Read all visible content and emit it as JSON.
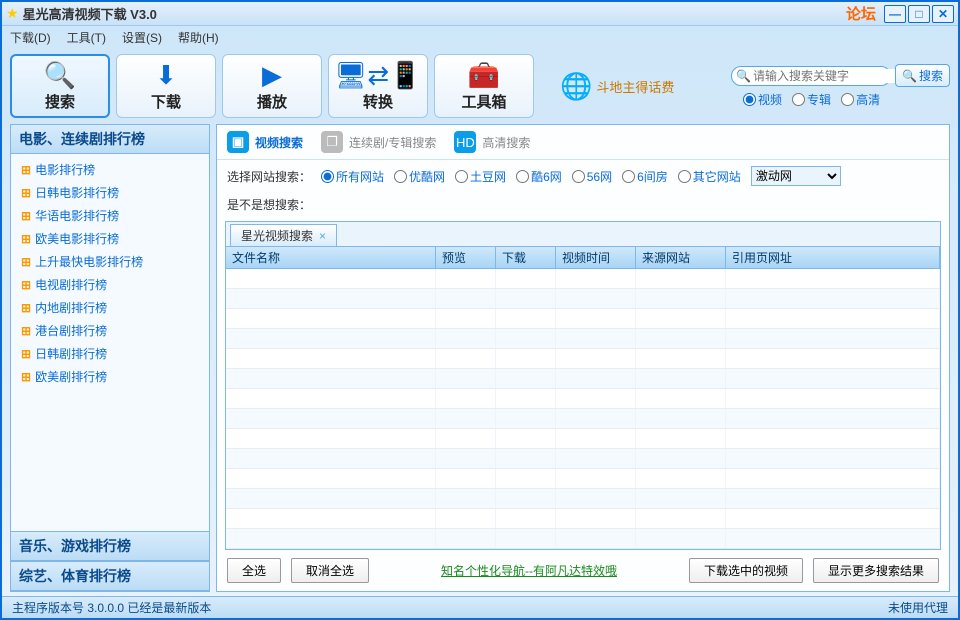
{
  "title": "星光高清视频下载  V3.0",
  "forum_link": "论坛",
  "menu": {
    "download": "下载(D)",
    "tools": "工具(T)",
    "settings": "设置(S)",
    "help": "帮助(H)"
  },
  "bigbuttons": {
    "search": "搜索",
    "download": "下载",
    "play": "播放",
    "convert": "转换",
    "toolbox": "工具箱"
  },
  "promo": "斗地主得话费",
  "search": {
    "placeholder": "请输入搜索关键字",
    "button": "搜索",
    "radios": {
      "video": "视频",
      "album": "专辑",
      "hd": "高清"
    }
  },
  "sidebar": {
    "headers": {
      "movies": "电影、连续剧排行榜",
      "music": "音乐、游戏排行榜",
      "variety": "综艺、体育排行榜"
    },
    "items": [
      "电影排行榜",
      "日韩电影排行榜",
      "华语电影排行榜",
      "欧美电影排行榜",
      "上升最快电影排行榜",
      "电视剧排行榜",
      "内地剧排行榜",
      "港台剧排行榜",
      "日韩剧排行榜",
      "欧美剧排行榜"
    ]
  },
  "main_tabs": {
    "video": "视频搜索",
    "series": "连续剧/专辑搜索",
    "hd": "高清搜索"
  },
  "filter": {
    "label": "选择网站搜索：",
    "sites": {
      "all": "所有网站",
      "youku": "优酷网",
      "tudou": "土豆网",
      "ku6": "酷6网",
      "w56": "56网",
      "room6": "6间房",
      "other": "其它网站"
    },
    "dropdown": "激动网"
  },
  "suggest_label": "是不是想搜索：",
  "grid": {
    "tab": "星光视频搜索",
    "cols": {
      "name": "文件名称",
      "preview": "预览",
      "download": "下载",
      "time": "视频时间",
      "source": "来源网站",
      "refer": "引用页网址"
    }
  },
  "buttons": {
    "select_all": "全选",
    "deselect_all": "取消全选",
    "promo_link": "知名个性化导航--有阿凡达特效哦",
    "download_selected": "下载选中的视频",
    "more_results": "显示更多搜索结果"
  },
  "status": {
    "version": "主程序版本号 3.0.0.0  已经是最新版本",
    "proxy": "未使用代理"
  }
}
